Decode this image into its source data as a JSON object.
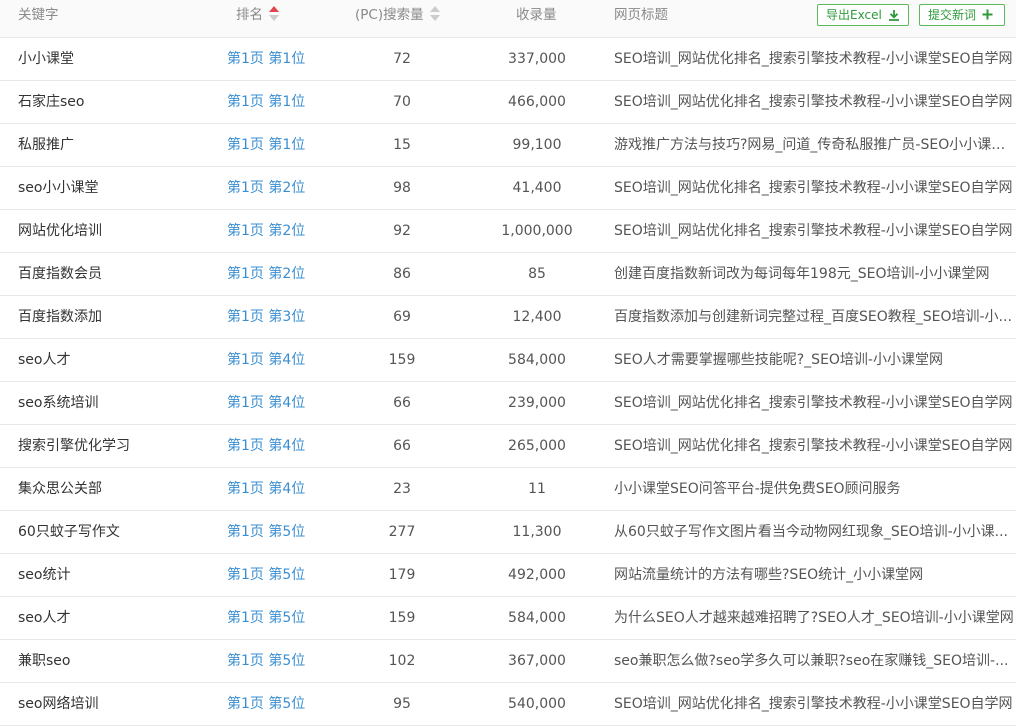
{
  "header": {
    "keyword": "关键字",
    "rank": "排名",
    "search_volume": "(PC)搜索量",
    "indexed": "收录量",
    "page_title": "网页标题",
    "export_button": "导出Excel",
    "submit_button": "提交新词",
    "rank_sort": "ascending",
    "accent_color": "#5cb85c",
    "sort_active_color": "#e0454d",
    "link_color": "#3b8fd1"
  },
  "rows": [
    {
      "keyword": "小小课堂",
      "page": "第1页",
      "pos": "第1位",
      "volume": "72",
      "indexed": "337,000",
      "title": "SEO培训_网站优化排名_搜索引擎技术教程-小小课堂SEO自学网"
    },
    {
      "keyword": "石家庄seo",
      "page": "第1页",
      "pos": "第1位",
      "volume": "70",
      "indexed": "466,000",
      "title": "SEO培训_网站优化排名_搜索引擎技术教程-小小课堂SEO自学网"
    },
    {
      "keyword": "私服推广",
      "page": "第1页",
      "pos": "第1位",
      "volume": "15",
      "indexed": "99,100",
      "title": "游戏推广方法与技巧?网易_问道_传奇私服推广员-SEO小小课堂..."
    },
    {
      "keyword": "seo小小课堂",
      "page": "第1页",
      "pos": "第2位",
      "volume": "98",
      "indexed": "41,400",
      "title": "SEO培训_网站优化排名_搜索引擎技术教程-小小课堂SEO自学网"
    },
    {
      "keyword": "网站优化培训",
      "page": "第1页",
      "pos": "第2位",
      "volume": "92",
      "indexed": "1,000,000",
      "title": "SEO培训_网站优化排名_搜索引擎技术教程-小小课堂SEO自学网"
    },
    {
      "keyword": "百度指数会员",
      "page": "第1页",
      "pos": "第2位",
      "volume": "86",
      "indexed": "85",
      "title": "创建百度指数新词改为每词每年198元_SEO培训-小小课堂网"
    },
    {
      "keyword": "百度指数添加",
      "page": "第1页",
      "pos": "第3位",
      "volume": "69",
      "indexed": "12,400",
      "title": "百度指数添加与创建新词完整过程_百度SEO教程_SEO培训-小..."
    },
    {
      "keyword": "seo人才",
      "page": "第1页",
      "pos": "第4位",
      "volume": "159",
      "indexed": "584,000",
      "title": "SEO人才需要掌握哪些技能呢?_SEO培训-小小课堂网"
    },
    {
      "keyword": "seo系统培训",
      "page": "第1页",
      "pos": "第4位",
      "volume": "66",
      "indexed": "239,000",
      "title": "SEO培训_网站优化排名_搜索引擎技术教程-小小课堂SEO自学网"
    },
    {
      "keyword": "搜索引擎优化学习",
      "page": "第1页",
      "pos": "第4位",
      "volume": "66",
      "indexed": "265,000",
      "title": "SEO培训_网站优化排名_搜索引擎技术教程-小小课堂SEO自学网"
    },
    {
      "keyword": "集众思公关部",
      "page": "第1页",
      "pos": "第4位",
      "volume": "23",
      "indexed": "11",
      "title": "小小课堂SEO问答平台-提供免费SEO顾问服务"
    },
    {
      "keyword": "60只蚊子写作文",
      "page": "第1页",
      "pos": "第5位",
      "volume": "277",
      "indexed": "11,300",
      "title": "从60只蚊子写作文图片看当今动物网红现象_SEO培训-小小课..."
    },
    {
      "keyword": "seo统计",
      "page": "第1页",
      "pos": "第5位",
      "volume": "179",
      "indexed": "492,000",
      "title": "网站流量统计的方法有哪些?SEO统计_小小课堂网"
    },
    {
      "keyword": "seo人才",
      "page": "第1页",
      "pos": "第5位",
      "volume": "159",
      "indexed": "584,000",
      "title": "为什么SEO人才越来越难招聘了?SEO人才_SEO培训-小小课堂网"
    },
    {
      "keyword": "兼职seo",
      "page": "第1页",
      "pos": "第5位",
      "volume": "102",
      "indexed": "367,000",
      "title": "seo兼职怎么做?seo学多久可以兼职?seo在家赚钱_SEO培训-..."
    },
    {
      "keyword": "seo网络培训",
      "page": "第1页",
      "pos": "第5位",
      "volume": "95",
      "indexed": "540,000",
      "title": "SEO培训_网站优化排名_搜索引擎技术教程-小小课堂SEO自学网"
    }
  ]
}
